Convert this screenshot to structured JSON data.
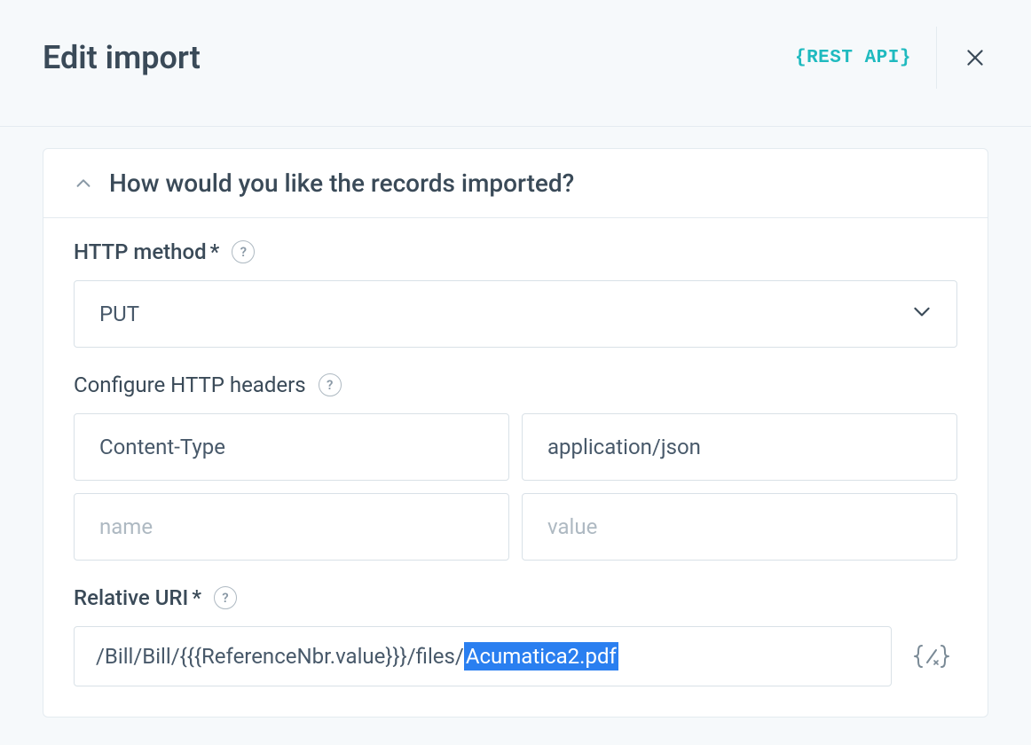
{
  "header": {
    "title": "Edit import",
    "badge": "{REST API}"
  },
  "panel": {
    "title": "How would you like the records imported?"
  },
  "http_method": {
    "label": "HTTP method",
    "required_marker": "*",
    "value": "PUT"
  },
  "http_headers": {
    "label": "Configure HTTP headers",
    "rows": [
      {
        "name": "Content-Type",
        "value": "application/json"
      },
      {
        "name": "",
        "value": ""
      }
    ],
    "name_placeholder": "name",
    "value_placeholder": "value"
  },
  "relative_uri": {
    "label": "Relative URI",
    "required_marker": "*",
    "value_prefix": "/Bill/Bill/{{{ReferenceNbr.value}}}/files/",
    "value_selected": "Acumatica2.pdf"
  }
}
